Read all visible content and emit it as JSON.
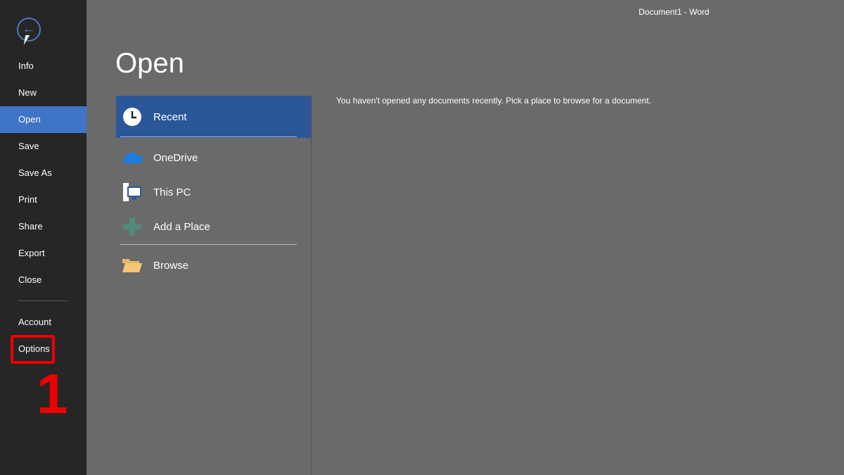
{
  "window": {
    "title": "Document1 - Word"
  },
  "sidebar": {
    "items": [
      {
        "label": "Info"
      },
      {
        "label": "New"
      },
      {
        "label": "Open"
      },
      {
        "label": "Save"
      },
      {
        "label": "Save As"
      },
      {
        "label": "Print"
      },
      {
        "label": "Share"
      },
      {
        "label": "Export"
      },
      {
        "label": "Close"
      },
      {
        "label": "Account"
      },
      {
        "label": "Options"
      }
    ],
    "annotation": "1"
  },
  "main": {
    "heading": "Open",
    "places": [
      {
        "label": "Recent"
      },
      {
        "label": "OneDrive"
      },
      {
        "label": "This PC"
      },
      {
        "label": "Add a Place"
      },
      {
        "label": "Browse"
      }
    ],
    "message": "You haven't opened any documents recently. Pick a place to browse for a document."
  },
  "colors": {
    "accent": "#3f74c6",
    "selected_place": "#2b579a",
    "annotation": "#ee0000"
  }
}
